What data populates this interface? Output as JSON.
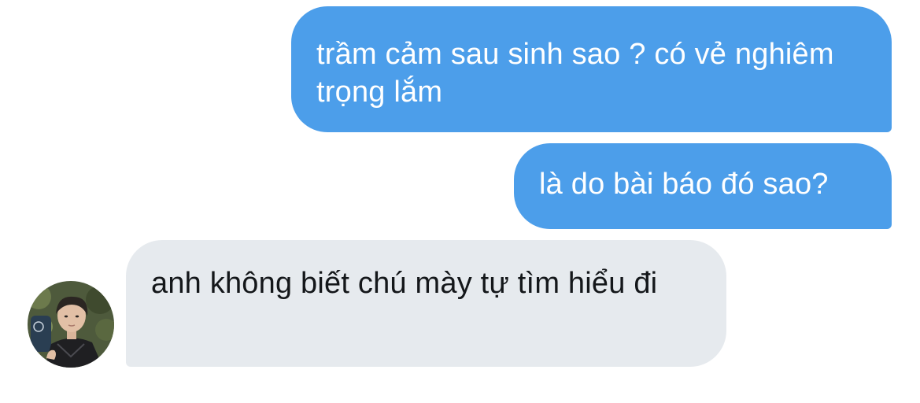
{
  "conversation": {
    "messages": [
      {
        "direction": "sent",
        "text": "trầm cảm sau sinh sao ? có vẻ nghiêm trọng lắm"
      },
      {
        "direction": "sent",
        "text": "là do bài báo đó sao?"
      },
      {
        "direction": "received",
        "text": "anh không biết chú mày tự tìm hiểu đi"
      }
    ]
  },
  "colors": {
    "sent_bubble": "#4c9eea",
    "received_bubble": "#e6eaee",
    "sent_text": "#ffffff",
    "received_text": "#14171a"
  },
  "icons": {
    "sender_avatar": "user-avatar-photo"
  }
}
